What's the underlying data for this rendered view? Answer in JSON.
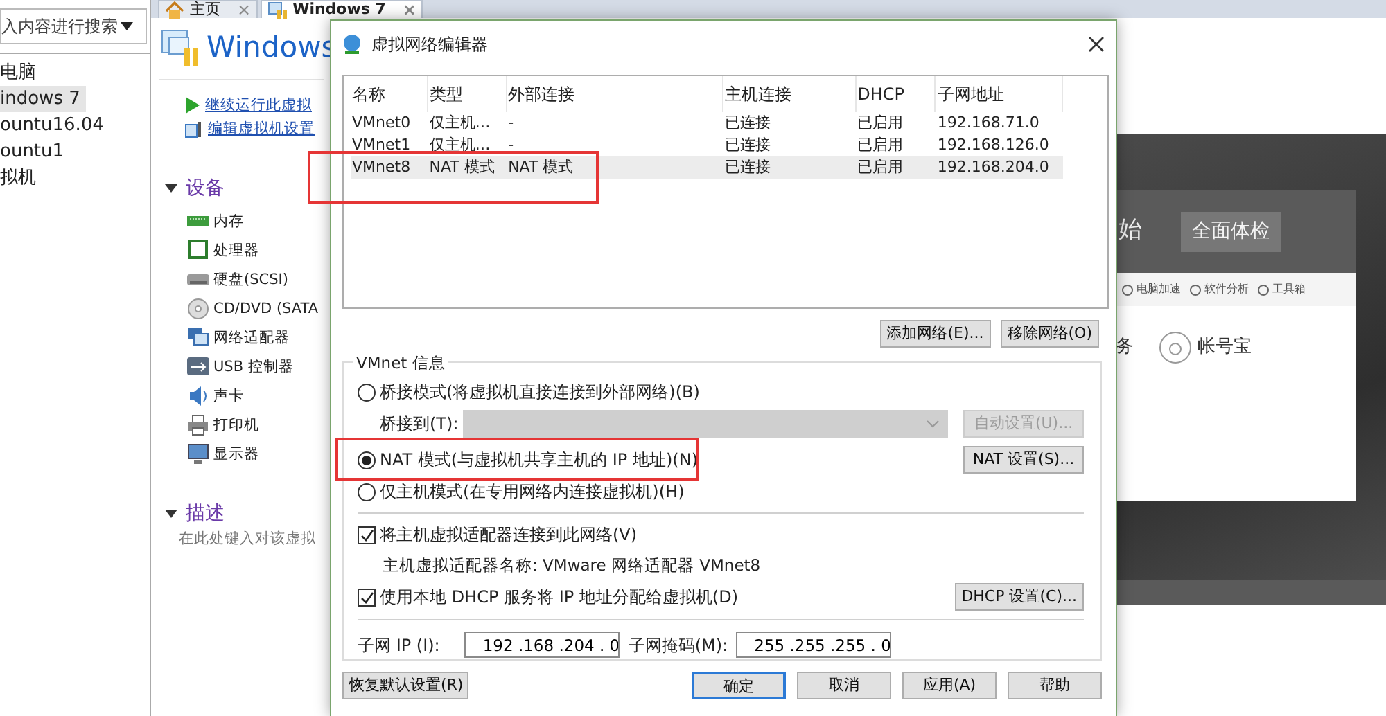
{
  "sidebar": {
    "search": {
      "placeholder": "入内容进行搜索"
    },
    "items": [
      {
        "label": "电脑",
        "selected": false
      },
      {
        "label": "indows 7",
        "selected": true
      },
      {
        "label": "ountu16.04",
        "selected": false
      },
      {
        "label": "ountu1",
        "selected": false
      },
      {
        "label": "拟机",
        "selected": false
      }
    ]
  },
  "tabs": [
    {
      "label": "主页",
      "close": "×",
      "selected": false
    },
    {
      "label": "Windows 7",
      "close": "×",
      "selected": true
    }
  ],
  "vm_summary": {
    "title": "Windows",
    "actions": [
      "继续运行此虚拟",
      "编辑虚拟机设置"
    ],
    "devices_heading": "设备",
    "devices": [
      "内存",
      "处理器",
      "硬盘(SCSI)",
      "CD/DVD (SATA",
      "网络适配器",
      "USB 控制器",
      "声卡",
      "打印机",
      "显示器"
    ],
    "description_heading": "描述",
    "description_placeholder": "在此处键入对该虚拟"
  },
  "vm_preview": {
    "header": "始",
    "scan_button": "全面体检",
    "tools": [
      "电脑加速",
      "软件分析",
      "工具箱"
    ],
    "task": "务",
    "account": "帐号宝"
  },
  "dialog": {
    "title": "虚拟网络编辑器",
    "table": {
      "columns": [
        "名称",
        "类型",
        "外部连接",
        "主机连接",
        "DHCP",
        "子网地址"
      ],
      "rows": [
        {
          "cells": [
            "VMnet0",
            "仅主机…",
            "-",
            "已连接",
            "已启用",
            "192.168.71.0"
          ],
          "selected": false,
          "highlighted": false
        },
        {
          "cells": [
            "VMnet1",
            "仅主机…",
            "-",
            "已连接",
            "已启用",
            "192.168.126.0"
          ],
          "selected": false,
          "highlighted": false
        },
        {
          "cells": [
            "VMnet8",
            "NAT 模式",
            "NAT 模式",
            "已连接",
            "已启用",
            "192.168.204.0"
          ],
          "selected": true,
          "highlighted": true
        }
      ]
    },
    "list_buttons": [
      "添加网络(E)...",
      "移除网络(O)"
    ],
    "group_title": "VMnet 信息",
    "modes": [
      {
        "label": "桥接模式(将虚拟机直接连接到外部网络)(B)",
        "selected": false,
        "highlighted": false
      },
      {
        "label": "NAT 模式(与虚拟机共享主机的 IP 地址)(N)",
        "selected": true,
        "highlighted": true
      },
      {
        "label": "仅主机模式(在专用网络内连接虚拟机)(H)",
        "selected": false,
        "highlighted": false
      }
    ],
    "bridge_to": {
      "label": "桥接到(T):",
      "disabled": true
    },
    "auto_button": {
      "label": "自动设置(U)...",
      "disabled": true
    },
    "nat_button": "NAT 设置(S)...",
    "connect_adapter": {
      "label": "将主机虚拟适配器连接到此网络(V)",
      "checked": true
    },
    "adapter_name": "主机虚拟适配器名称: VMware 网络适配器 VMnet8",
    "use_dhcp": {
      "label": "使用本地 DHCP 服务将 IP 地址分配给虚拟机(D)",
      "checked": true
    },
    "dhcp_button": "DHCP 设置(C)...",
    "subnet_ip": {
      "label": "子网 IP (I):",
      "value": "192 .168 .204 . 0"
    },
    "subnet_mask": {
      "label": "子网掩码(M):",
      "value": "255 .255 .255 . 0"
    },
    "footer_buttons": [
      {
        "label": "恢复默认设置(R)",
        "default": false
      },
      {
        "label": "确定",
        "default": true
      },
      {
        "label": "取消",
        "default": false
      },
      {
        "label": "应用(A)",
        "default": false
      },
      {
        "label": "帮助",
        "default": false
      }
    ]
  }
}
